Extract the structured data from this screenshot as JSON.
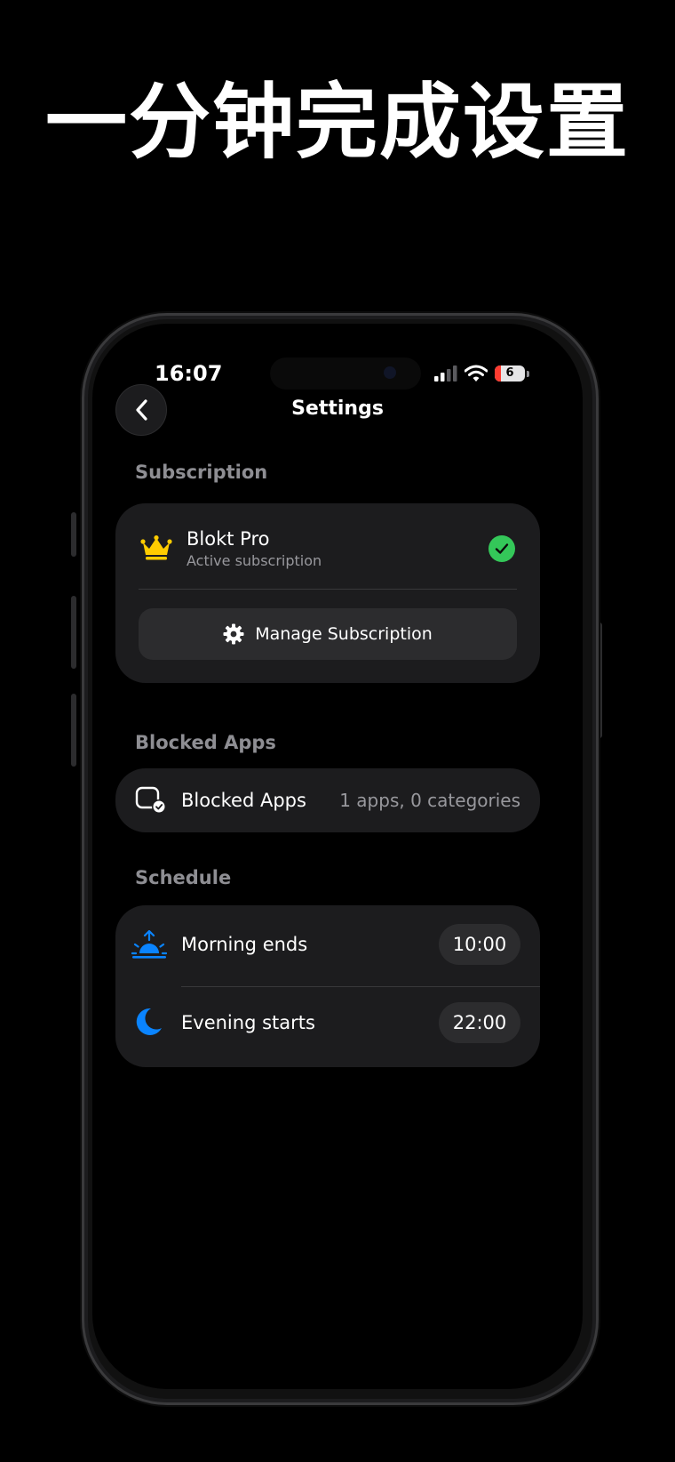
{
  "headline": "一分钟完成设置",
  "status_bar": {
    "time": "16:07",
    "battery_level": "6"
  },
  "nav": {
    "title": "Settings",
    "back_icon": "chevron-left-icon"
  },
  "sections": {
    "subscription": {
      "label": "Subscription",
      "plan_name": "Blokt Pro",
      "plan_status": "Active subscription",
      "manage_label": "Manage Subscription",
      "crown_color": "#ffcc00",
      "check_color": "#34c759"
    },
    "blocked_apps": {
      "label": "Blocked Apps",
      "row_label": "Blocked Apps",
      "row_value": "1 apps, 0 categories"
    },
    "schedule": {
      "label": "Schedule",
      "morning_label": "Morning ends",
      "morning_time": "10:00",
      "evening_label": "Evening starts",
      "evening_time": "22:00",
      "icon_color": "#0a84ff"
    }
  }
}
